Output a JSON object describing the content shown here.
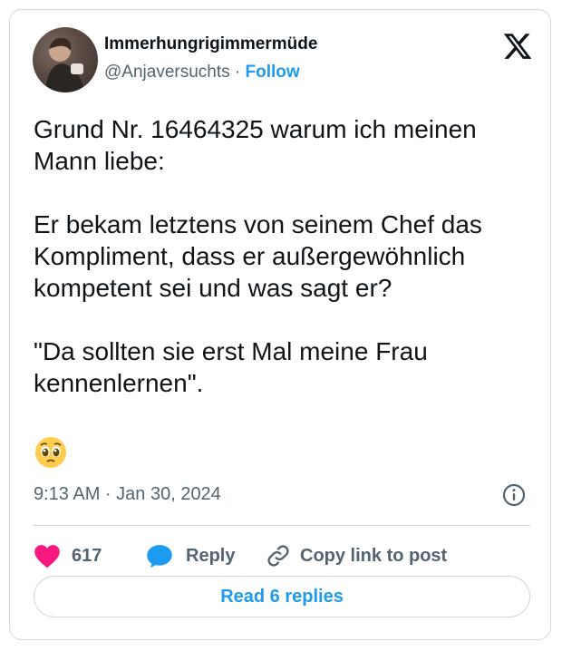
{
  "author": {
    "display_name": "Immerhungrigimmermüde",
    "handle": "@Anjaversuchts",
    "separator": "·",
    "follow_label": "Follow"
  },
  "tweet": {
    "text": "Grund Nr. 16464325 warum ich meinen Mann liebe:\n\nEr bekam letztens von seinem Chef das Kompliment, dass er außergewöhnlich kompetent sei und was sagt er?\n\n\"Da sollten sie erst Mal meine Frau kennenlernen\".",
    "emoji": "pleading-face-emoji",
    "timestamp": "9:13 AM · Jan 30, 2024"
  },
  "actions": {
    "like_count": "617",
    "reply_label": "Reply",
    "copy_link_label": "Copy link to post"
  },
  "footer": {
    "read_replies_label": "Read 6 replies"
  },
  "colors": {
    "accent": "#1d9bf0",
    "like": "#f91880",
    "secondary_text": "#536471",
    "border": "#cfd9de"
  },
  "icons": [
    "x-logo-icon",
    "info-icon",
    "heart-icon",
    "reply-bubble-icon",
    "link-icon"
  ]
}
